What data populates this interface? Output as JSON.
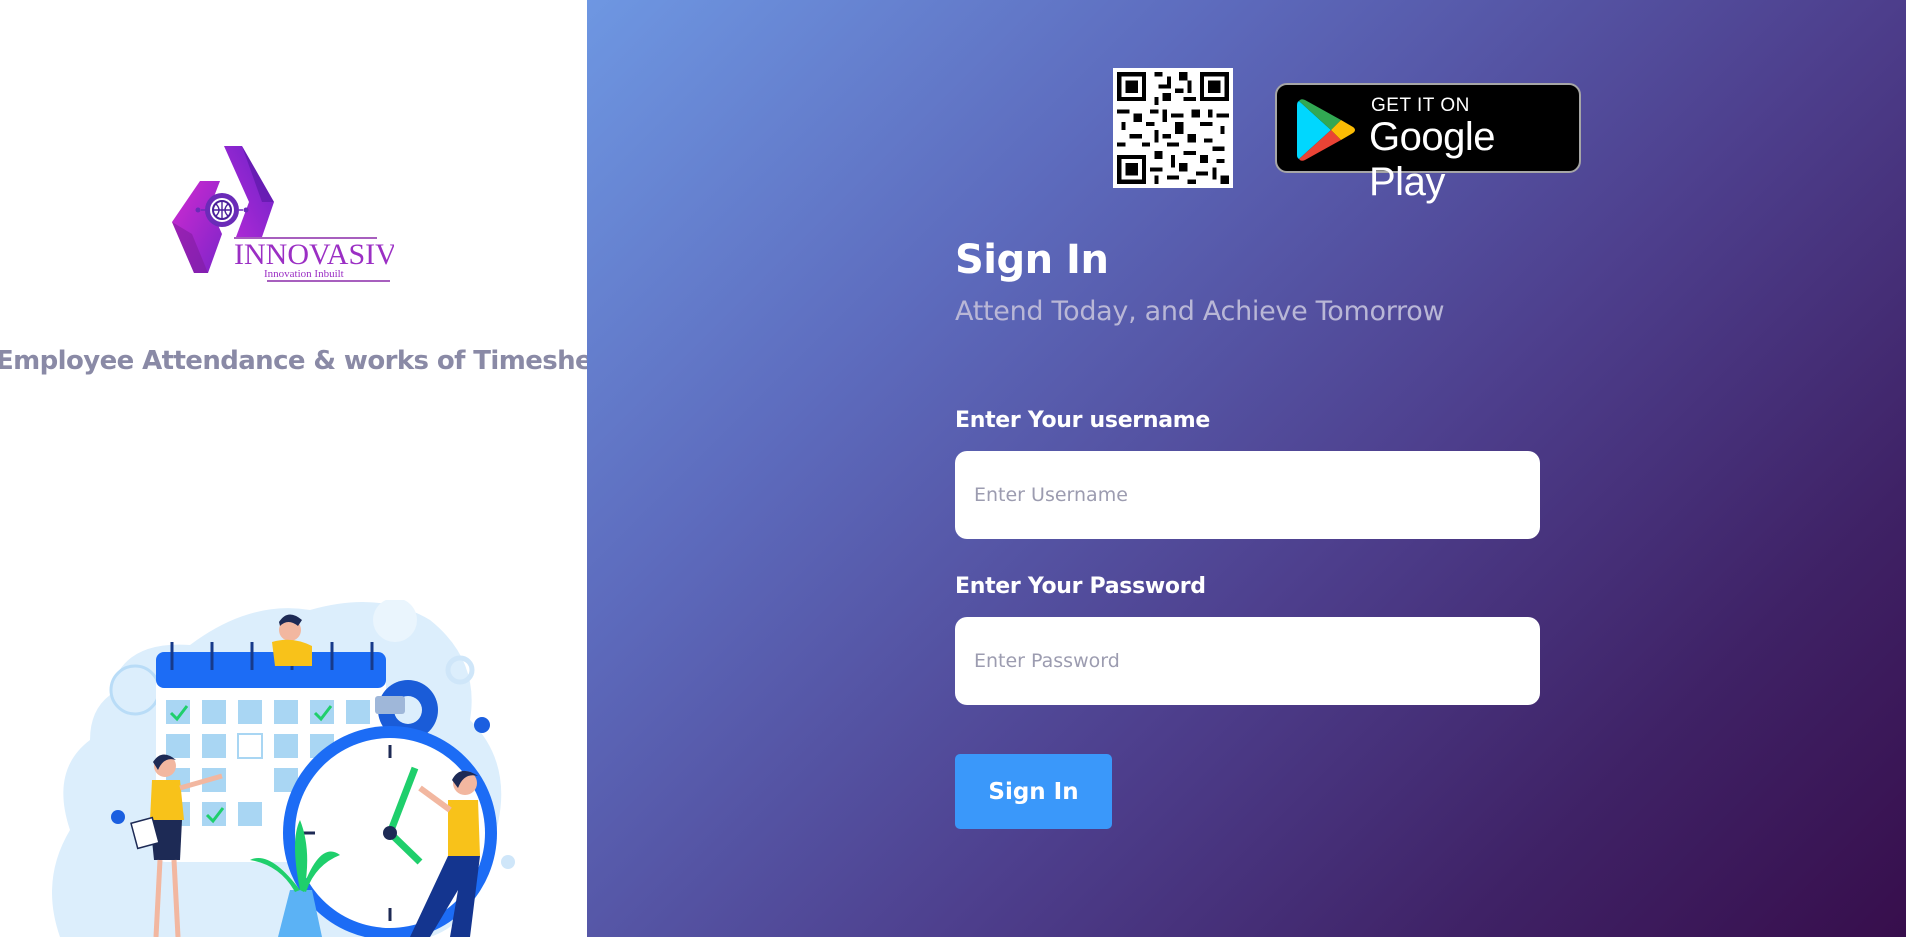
{
  "brand": {
    "name": "INNOVASIV",
    "tagline": "Innovation Inbuilt"
  },
  "left": {
    "heading": "Employee Attendance & works of Timesheet"
  },
  "store_badge": {
    "top_text": "GET IT ON",
    "main_text": "Google Play"
  },
  "signin": {
    "title": "Sign In",
    "subtitle": "Attend Today, and Achieve Tomorrow",
    "username_label": "Enter Your username",
    "username_placeholder": "Enter Username",
    "password_label": "Enter Your Password",
    "password_placeholder": "Enter Password",
    "button_label": "Sign In"
  },
  "colors": {
    "accent": "#3a98fa",
    "logo_purple": "#9b2fc4",
    "gradient_start": "#6e97e2",
    "gradient_end": "#370e4c"
  }
}
